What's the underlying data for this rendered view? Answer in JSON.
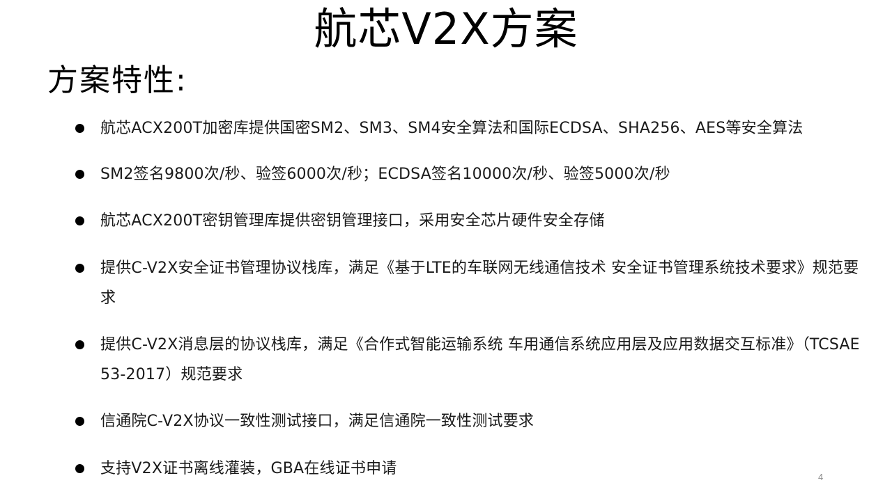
{
  "slide": {
    "title": "航芯V2X方案",
    "section_heading": "方案特性:",
    "bullets": [
      {
        "text": "航芯ACX200T加密库提供国密SM2、SM3、SM4安全算法和国际ECDSA、SHA256、AES等安全算法"
      },
      {
        "text": "SM2签名9800次/秒、验签6000次/秒；ECDSA签名10000次/秒、验签5000次/秒"
      },
      {
        "text": "航芯ACX200T密钥管理库提供密钥管理接口，采用安全芯片硬件安全存储"
      },
      {
        "text": "提供C-V2X安全证书管理协议栈库，满足《基于LTE的车联网无线通信技术 安全证书管理系统技术要求》规范要求"
      },
      {
        "text": "提供C-V2X消息层的协议栈库，满足《合作式智能运输系统 车用通信系统应用层及应用数据交互标准》（TCSAE 53-2017）规范要求"
      },
      {
        "text": "信通院C-V2X协议一致性测试接口，满足信通院一致性测试要求"
      },
      {
        "text": "支持V2X证书离线灌装，GBA在线证书申请"
      }
    ],
    "page_number": "4"
  }
}
